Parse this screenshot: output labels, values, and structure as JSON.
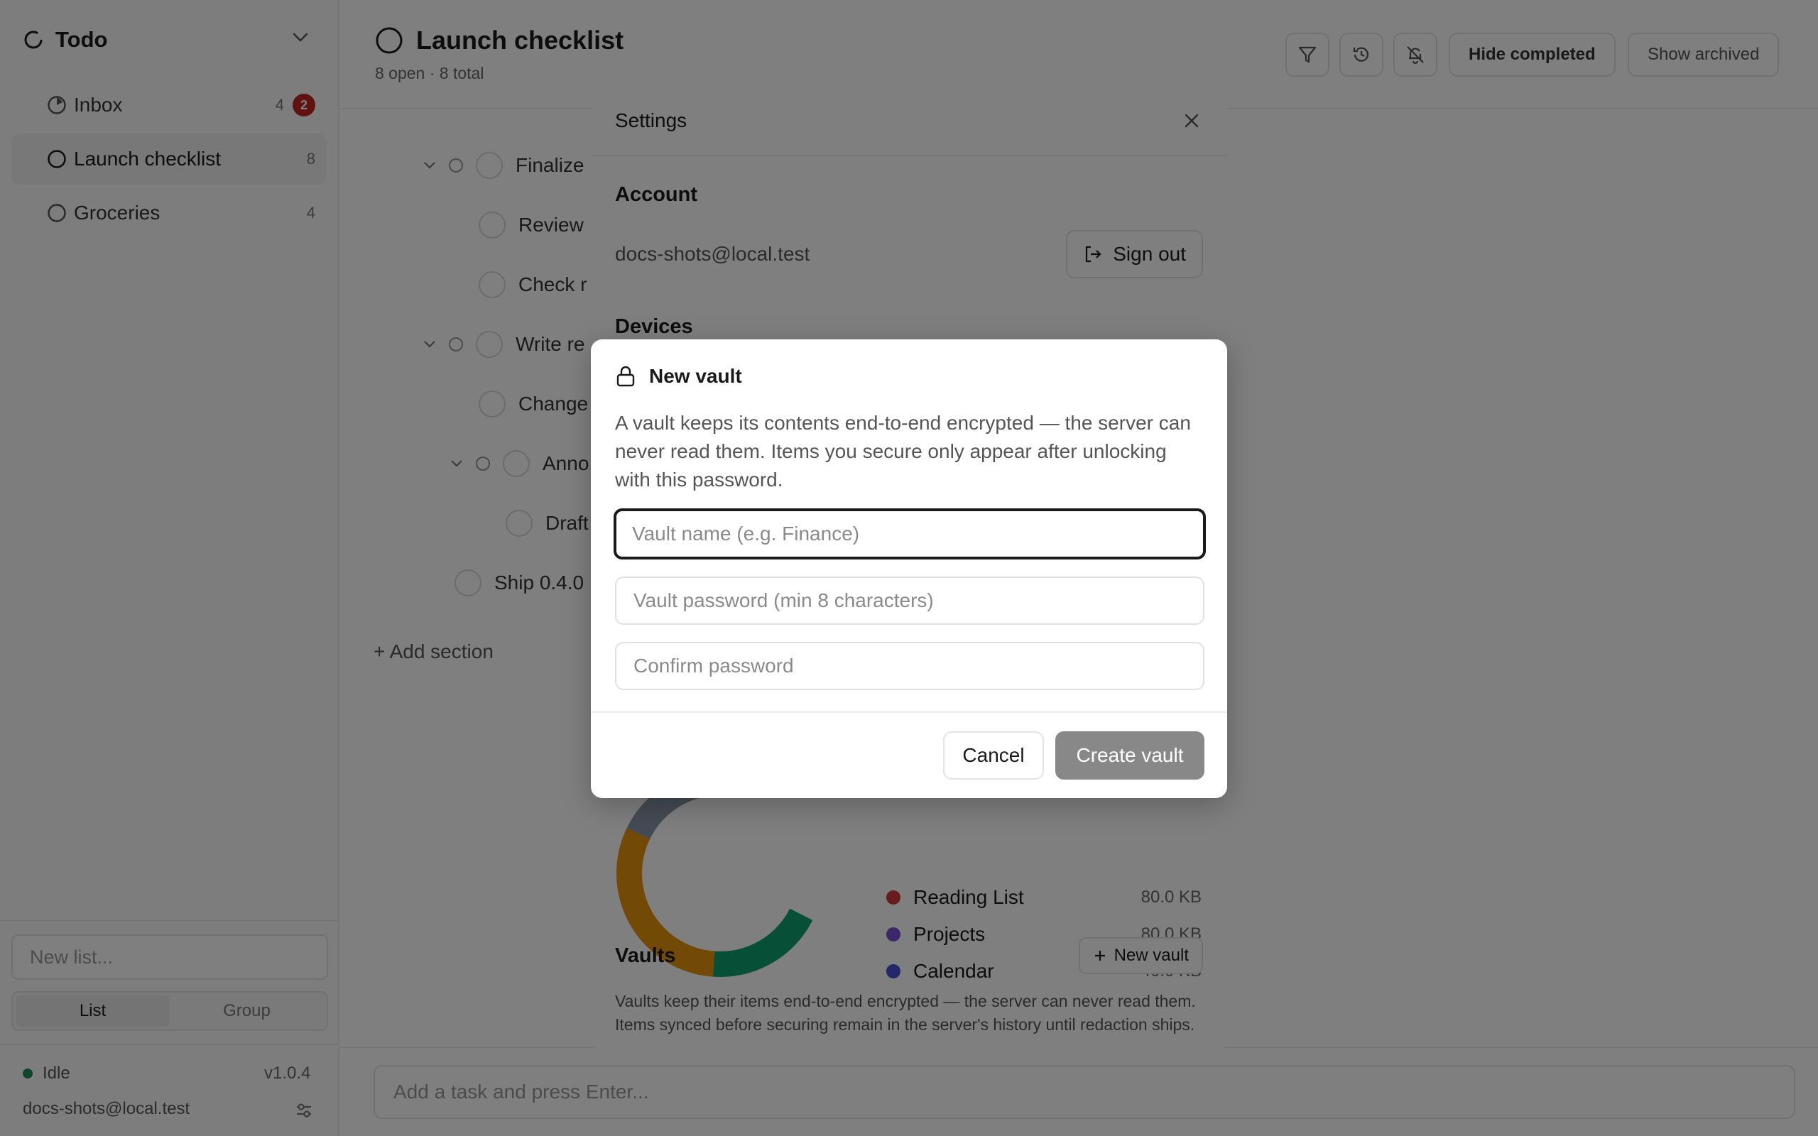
{
  "sidebar": {
    "app_title": "Todo",
    "items": [
      {
        "label": "Inbox",
        "count": "4",
        "badge": "2"
      },
      {
        "label": "Launch checklist",
        "count": "8"
      },
      {
        "label": "Groceries",
        "count": "4"
      }
    ],
    "new_list_placeholder": "New list...",
    "view_modes": [
      "List",
      "Group"
    ],
    "active_view_mode": "List",
    "sync_status": "Idle",
    "version": "v1.0.4",
    "user_email": "docs-shots@local.test"
  },
  "header": {
    "title": "Launch checklist",
    "subtitle": "8 open · 8 total",
    "hide_completed_label": "Hide completed",
    "show_archived_label": "Show archived",
    "icons": [
      "filter-icon",
      "history-icon",
      "bell-off-icon"
    ]
  },
  "tasks": [
    {
      "label": "Finalize"
    },
    {
      "label": "Review"
    },
    {
      "label": "Check r"
    },
    {
      "label": "Write re"
    },
    {
      "label": "Change"
    },
    {
      "label": "Anno"
    },
    {
      "label": "Draft"
    },
    {
      "label": "Ship 0.4.0"
    }
  ],
  "add_section_label": "+ Add section",
  "add_task_placeholder": "Add a task and press Enter...",
  "settings": {
    "title": "Settings",
    "account_heading": "Account",
    "account_email": "docs-shots@local.test",
    "sign_out_label": "Sign out",
    "devices_heading": "Devices",
    "storage_legend": [
      {
        "name": "Reading List",
        "size": "80.0 KB",
        "color": "#d13b3b"
      },
      {
        "name": "Projects",
        "size": "80.0 KB",
        "color": "#7b4fd6"
      },
      {
        "name": "Calendar",
        "size": "40.0 KB",
        "color": "#4a4fd6"
      }
    ],
    "vaults_heading": "Vaults",
    "new_vault_button": "New vault",
    "vaults_description": "Vaults keep their items end-to-end encrypted — the server can never read them. Items synced before securing remain in the server's history until redaction ships."
  },
  "new_vault_dialog": {
    "title": "New vault",
    "description": "A vault keeps its contents end-to-end encrypted — the server can never read them. Items you secure only appear after unlocking with this password.",
    "name_placeholder": "Vault name (e.g. Finance)",
    "password_placeholder": "Vault password (min 8 characters)",
    "confirm_placeholder": "Confirm password",
    "cancel_label": "Cancel",
    "create_label": "Create vault"
  },
  "colors": {
    "badge": "#c0241f",
    "status_idle": "#1a8a5a",
    "primary_disabled": "#888888",
    "donut_green": "#0f9e6e",
    "donut_orange": "#e7930d",
    "donut_slate": "#8a96a8"
  }
}
